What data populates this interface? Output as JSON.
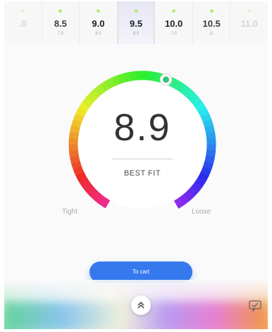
{
  "sizes": [
    {
      "value": ".0",
      "sub": "..."
    },
    {
      "value": "8.5",
      "sub": "7.5"
    },
    {
      "value": "9.0",
      "sub": "8.0"
    },
    {
      "value": "9.5",
      "sub": "8.5"
    },
    {
      "value": "10.0",
      "sub": "7.0"
    },
    {
      "value": "10.5",
      "sub": "11"
    },
    {
      "value": "11.0",
      "sub": "..."
    }
  ],
  "selected_size": "9.5",
  "fit": {
    "score": "8.9",
    "label": "BEST FIT",
    "tight_label": "Tight",
    "loose_label": "Loose"
  },
  "cart": {
    "label": "To cart"
  },
  "icons": {
    "expand": "chevron-double-up-icon",
    "feedback": "feedback-icon",
    "indicator": "dot-icon"
  },
  "colors": {
    "accent": "#3679ee",
    "knob": "#34c47a"
  }
}
